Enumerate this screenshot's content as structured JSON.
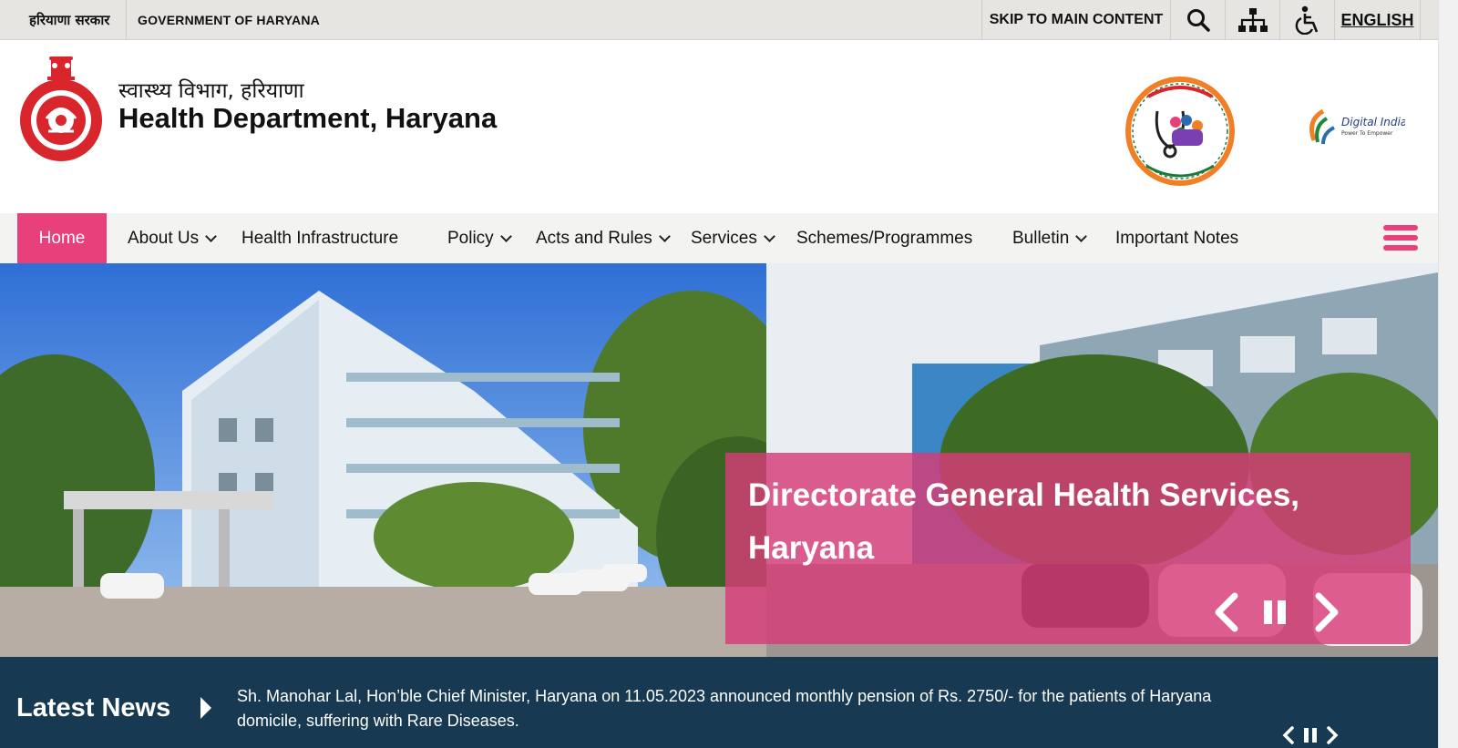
{
  "topbar": {
    "gov_hindi": "हरियाणा सरकार",
    "gov_english": "GOVERNMENT OF HARYANA",
    "skip_label": "SKIP TO MAIN CONTENT",
    "language_label": "ENGLISH",
    "icons": [
      "search-icon",
      "sitemap-icon",
      "accessibility-icon"
    ]
  },
  "header": {
    "dept_hindi": "स्वास्थ्य विभाग, हरियाणा",
    "dept_english": "Health Department, Haryana"
  },
  "nav": {
    "items": [
      {
        "label": "Home",
        "active": true
      },
      {
        "label": "About Us",
        "dropdown": true
      },
      {
        "label": "Health Infrastructure"
      },
      {
        "label": "Policy",
        "dropdown": true
      },
      {
        "label": "Acts and Rules",
        "dropdown": true
      },
      {
        "label": "Services",
        "dropdown": true
      },
      {
        "label": "Schemes/Programmes"
      },
      {
        "label": "Bulletin",
        "dropdown": true
      },
      {
        "label": "Important Notes"
      }
    ]
  },
  "hero": {
    "caption": "Directorate General Health Services, Haryana"
  },
  "news": {
    "label": "Latest News",
    "text": "Sh. Manohar Lal, Hon’ble Chief Minister, Haryana on 11.05.2023 announced monthly pension of Rs. 2750/- for the patients of Haryana domicile, suffering with Rare Diseases."
  },
  "colors": {
    "accent": "#e8407a",
    "topbar_bg": "#e6e5e1",
    "news_bg": "#173951",
    "caption_bg": "#d73c78"
  }
}
